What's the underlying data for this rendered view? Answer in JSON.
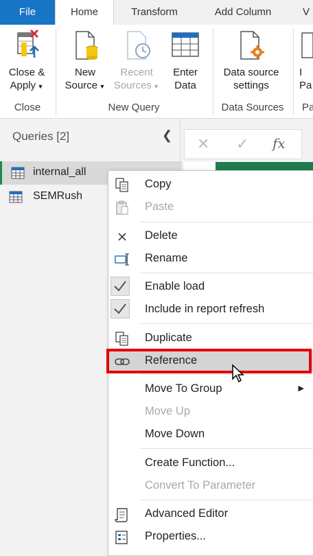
{
  "tabs": [
    {
      "label": "File"
    },
    {
      "label": "Home"
    },
    {
      "label": "Transform"
    },
    {
      "label": "Add Column"
    },
    {
      "label": "V"
    }
  ],
  "ribbon": {
    "close_apply": {
      "line1": "Close &",
      "line2": "Apply"
    },
    "new_source": {
      "line1": "New",
      "line2": "Source"
    },
    "recent_sources": {
      "line1": "Recent",
      "line2": "Sources"
    },
    "enter_data": {
      "line1": "Enter",
      "line2": "Data"
    },
    "data_source_settings": {
      "line1": "Data source",
      "line2": "settings"
    },
    "params": {
      "line1": "I",
      "line2": "Pa"
    },
    "groups": {
      "close": "Close",
      "new_query": "New Query",
      "data_sources": "Data Sources",
      "param_group": "Pa"
    }
  },
  "queries": {
    "header": "Queries [2]",
    "items": [
      "internal_all",
      "SEMRush"
    ]
  },
  "formula_bar": {
    "fx": "fx"
  },
  "context_menu": {
    "copy": "Copy",
    "paste": "Paste",
    "delete": "Delete",
    "rename": "Rename",
    "enable_load": "Enable load",
    "include_refresh": "Include in report refresh",
    "duplicate": "Duplicate",
    "reference": "Reference",
    "move_to_group": "Move To Group",
    "move_up": "Move Up",
    "move_down": "Move Down",
    "create_function": "Create Function...",
    "convert_parameter": "Convert To Parameter",
    "advanced_editor": "Advanced Editor",
    "properties": "Properties..."
  },
  "colors": {
    "file_tab": "#1874c5",
    "highlight_border": "#e00000",
    "selected_query_accent": "#1d8a4b"
  }
}
